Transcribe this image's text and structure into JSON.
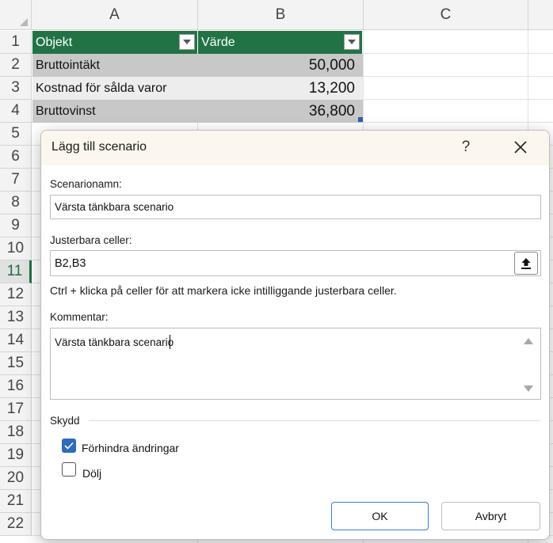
{
  "sheet": {
    "columns": [
      "A",
      "B",
      "C"
    ],
    "rows": [
      "1",
      "2",
      "3",
      "4",
      "5",
      "6",
      "7",
      "8",
      "9",
      "10",
      "11",
      "12",
      "13",
      "14",
      "15",
      "16",
      "17",
      "18",
      "19",
      "20",
      "21",
      "22"
    ],
    "active_row": "11",
    "table": {
      "headers": [
        "Objekt",
        "Värde"
      ],
      "rows": [
        {
          "item": "Bruttointäkt",
          "value": "50,000"
        },
        {
          "item": "Kostnad för sålda varor",
          "value": "13,200"
        },
        {
          "item": "Bruttovinst",
          "value": "36,800"
        }
      ]
    },
    "colors": {
      "header_green": "#217346",
      "band_dark": "#c8c8c8",
      "band_light": "#ededed"
    }
  },
  "dialog": {
    "title": "Lägg till scenario",
    "help_label": "?",
    "close_icon": "close-icon",
    "scenario_name_label": "Scenarionamn:",
    "scenario_name_value": "Värsta tänkbara scenario",
    "changing_cells_label": "Justerbara celler:",
    "changing_cells_value": "B2,B3",
    "collapse_icon": "upload-arrow-icon",
    "hint": "Ctrl + klicka på celler för att markera icke intilliggande justerbara celler.",
    "comment_label": "Kommentar:",
    "comment_value": "Värsta tänkbara scenario",
    "protection_label": "Skydd",
    "prevent_changes_label": "Förhindra ändringar",
    "prevent_changes_checked": true,
    "hide_label": "Dölj",
    "hide_checked": false,
    "ok_label": "OK",
    "cancel_label": "Avbryt"
  }
}
